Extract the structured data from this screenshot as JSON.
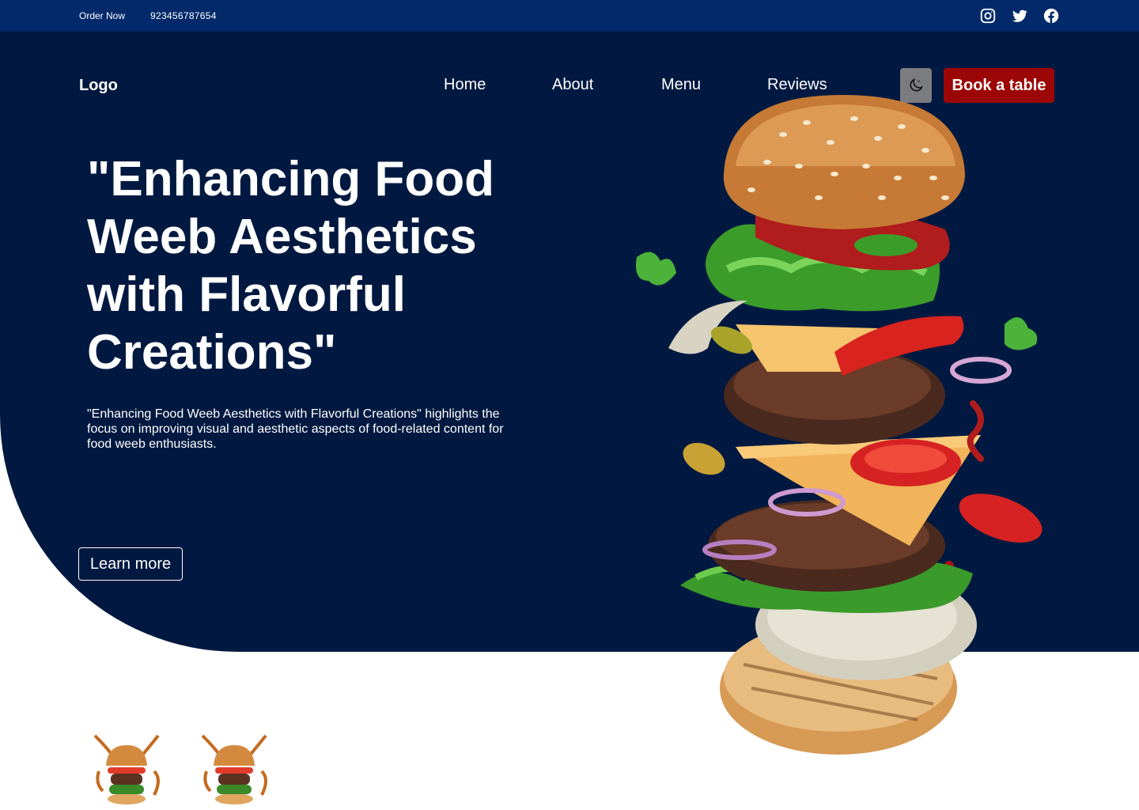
{
  "topbar": {
    "order_label": "Order Now",
    "phone": "923456787654",
    "icons": [
      "instagram-icon",
      "twitter-icon",
      "facebook-icon"
    ]
  },
  "header": {
    "logo": "Logo",
    "nav": [
      "Home",
      "About",
      "Menu",
      "Reviews"
    ],
    "theme_icon": "moon-icon",
    "book_label": "Book a table"
  },
  "hero": {
    "headline": "\"Enhancing Food Weeb Aesthetics with Flavorful Creations\"",
    "description": "\"Enhancing Food Weeb Aesthetics with Flavorful Creations\" highlights the focus on improving visual and aesthetic aspects of food-related content for food weeb enthusiasts.",
    "cta_label": "Learn more"
  },
  "colors": {
    "topbar_bg": "#022a6a",
    "hero_bg": "#011940",
    "accent_red": "#9c0606",
    "theme_button_bg": "#7b7c80"
  }
}
